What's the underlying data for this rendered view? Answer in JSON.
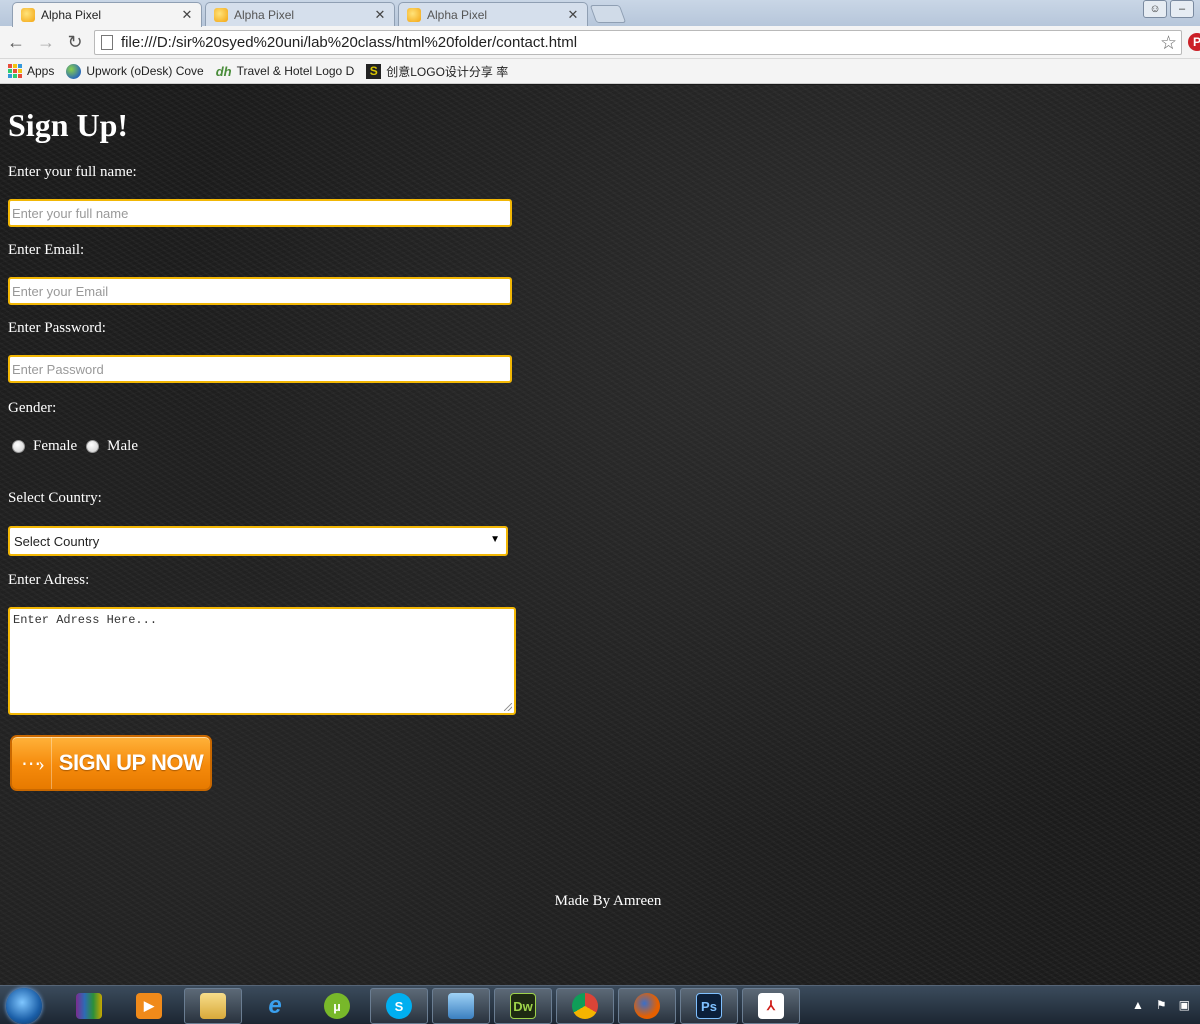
{
  "browser": {
    "tabs": [
      {
        "title": "Alpha Pixel",
        "active": true
      },
      {
        "title": "Alpha Pixel",
        "active": false
      },
      {
        "title": "Alpha Pixel",
        "active": false
      }
    ],
    "url": "file:///D:/sir%20syed%20uni/lab%20class/html%20folder/contact.html",
    "bookmarks": [
      {
        "label": "Apps",
        "icon": "apps-grid-icon"
      },
      {
        "label": "Upwork (oDesk) Cove",
        "icon": "upwork-globe-icon"
      },
      {
        "label": "Travel & Hotel Logo D",
        "icon": "dh-logo-icon"
      },
      {
        "label": "创意LOGO设计分享 率",
        "icon": "s-logo-icon"
      }
    ]
  },
  "form": {
    "heading": "Sign Up!",
    "name_label": "Enter your full name:",
    "name_placeholder": "Enter your full name",
    "email_label": "Enter Email:",
    "email_placeholder": "Enter your Email",
    "password_label": "Enter Password:",
    "password_placeholder": "Enter Password",
    "gender_label": "Gender:",
    "gender_options": [
      "Female",
      "Male"
    ],
    "country_label": "Select Country:",
    "country_selected": "Select Country",
    "address_label": "Enter Adress:",
    "address_placeholder": "Enter Adress Here...",
    "submit_label": "SIGN UP NOW"
  },
  "footer": {
    "text": "Made By Amreen"
  },
  "taskbar": {
    "dw_label": "Dw",
    "ps_label": "Ps"
  },
  "colors": {
    "input_border": "#f2b705",
    "button_orange": "#f58a0b",
    "page_background": "#1e1e1e"
  }
}
